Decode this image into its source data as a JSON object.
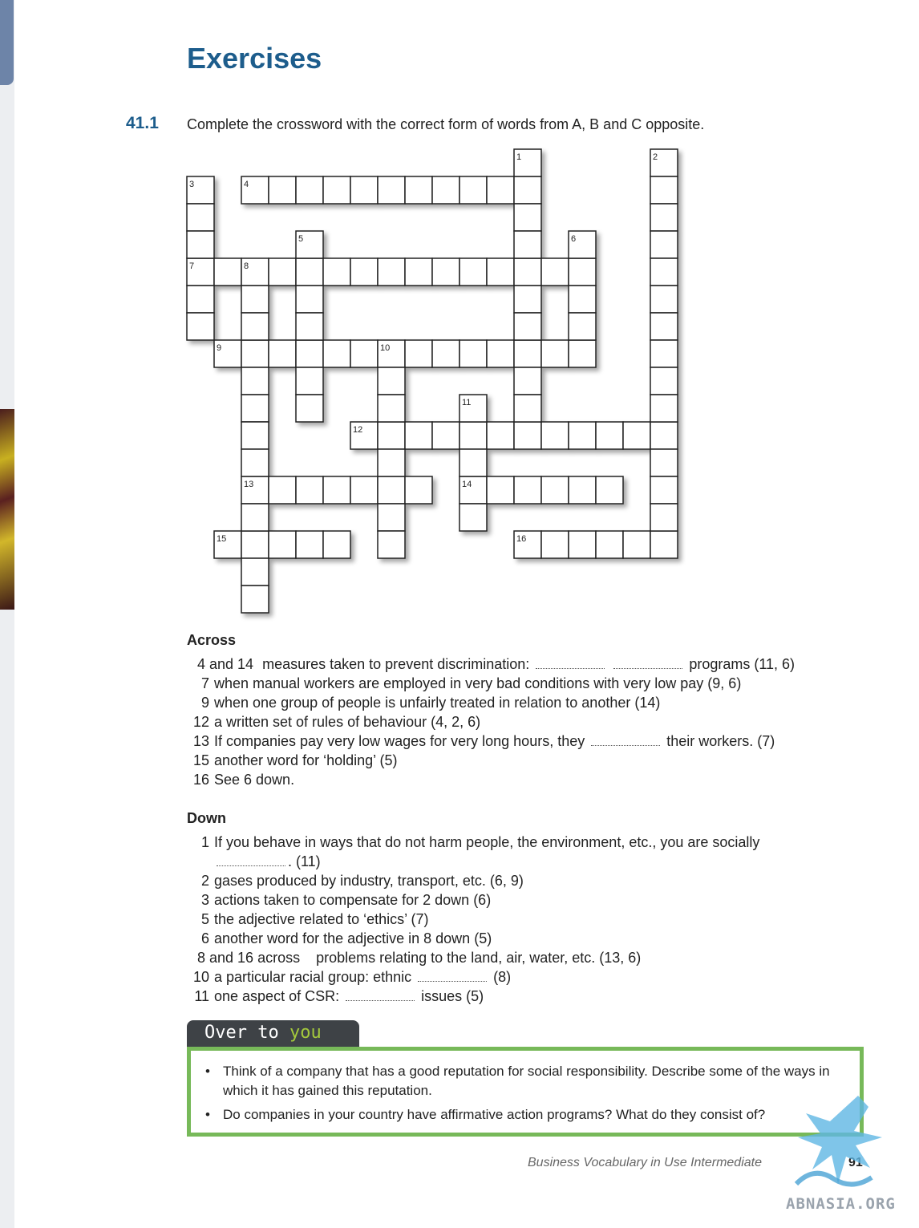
{
  "page": {
    "title": "Exercises",
    "exercise_number": "41.1",
    "instruction": "Complete the crossword with the correct form of words from A, B and C opposite."
  },
  "crossword": {
    "numbers": [
      "1",
      "2",
      "3",
      "4",
      "5",
      "6",
      "7",
      "8",
      "9",
      "10",
      "11",
      "12",
      "13",
      "14",
      "15",
      "16"
    ]
  },
  "across": {
    "heading": "Across",
    "clues": [
      {
        "num": "4 and 14",
        "text_before": "measures taken to prevent discrimination:",
        "text_after": "programs (11, 6)"
      },
      {
        "num": "7",
        "text": "when manual workers are employed in very bad conditions with very low pay (9, 6)"
      },
      {
        "num": "9",
        "text": "when one group of people is unfairly treated in relation to another (14)"
      },
      {
        "num": "12",
        "text": "a written set of rules of behaviour (4, 2, 6)"
      },
      {
        "num": "13",
        "text_before": "If companies pay very low wages for very long hours, they",
        "text_after": "their workers. (7)"
      },
      {
        "num": "15",
        "text": "another word for ‘holding’ (5)"
      },
      {
        "num": "16",
        "text": "See 6 down."
      }
    ]
  },
  "down": {
    "heading": "Down",
    "clues": [
      {
        "num": "1",
        "text": "If you behave in ways that do not harm people, the environment, etc., you are socially",
        "text_cont": ". (11)"
      },
      {
        "num": "2",
        "text": "gases produced by industry, transport, etc. (6, 9)"
      },
      {
        "num": "3",
        "text": "actions taken to compensate for 2 down (6)"
      },
      {
        "num": "5",
        "text": "the adjective related to ‘ethics’ (7)"
      },
      {
        "num": "6",
        "text": "another word for the adjective in 8 down (5)"
      },
      {
        "num": "8 and 16 across",
        "text": "problems relating to the land, air, water, etc. (13, 6)"
      },
      {
        "num": "10",
        "text_before": "a particular racial group: ethnic",
        "text_after": "(8)"
      },
      {
        "num": "11",
        "text_before": "one aspect of CSR:",
        "text_after": "issues (5)"
      }
    ]
  },
  "over_to_you": {
    "title_part1": "Over to ",
    "title_part2": "you",
    "items": [
      "Think of a company that has a good reputation for social responsibility. Describe some of the ways in which it has gained this reputation.",
      "Do companies in your country have affirmative action programs? What do they consist of?"
    ]
  },
  "footer": {
    "book_title": "Business Vocabulary in Use Intermediate",
    "page_number": "91",
    "watermark": "ABNASIA.ORG"
  },
  "colors": {
    "heading_blue": "#1d5d8c",
    "box_green": "#77b959",
    "tab_dark": "#3e4246",
    "you_green": "#a4c93c"
  }
}
